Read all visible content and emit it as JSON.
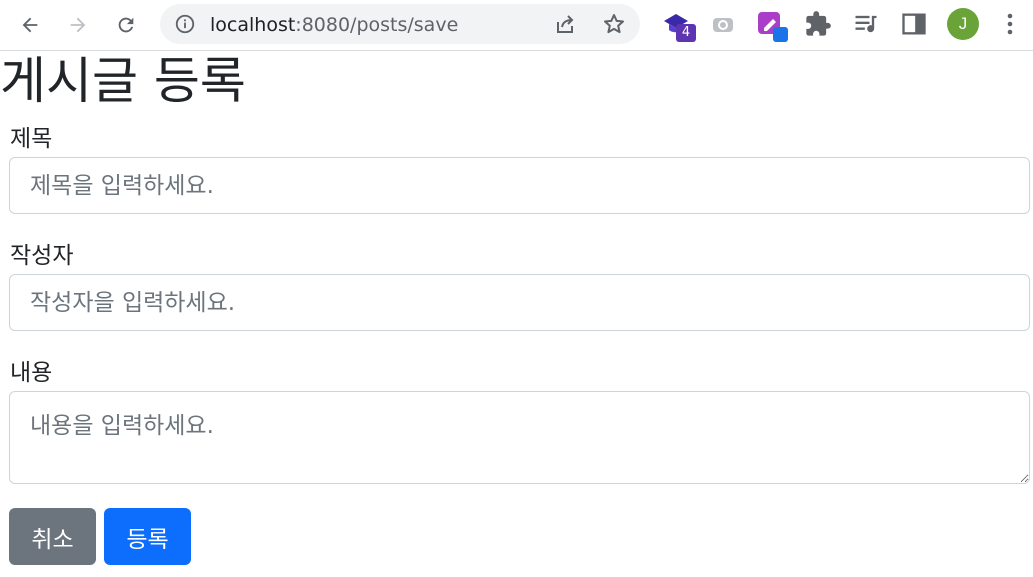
{
  "browser": {
    "url_host": "localhost",
    "url_path": ":8080/posts/save",
    "extension_badge": "4",
    "profile_initial": "J"
  },
  "page": {
    "title": "게시글 등록",
    "fields": {
      "title_label": "제목",
      "title_placeholder": "제목을 입력하세요.",
      "author_label": "작성자",
      "author_placeholder": "작성자을 입력하세요.",
      "content_label": "내용",
      "content_placeholder": "내용을 입력하세요."
    },
    "buttons": {
      "cancel": "취소",
      "save": "등록"
    }
  },
  "colors": {
    "cancel_button": "#6c757d",
    "save_button": "#0d6efd",
    "avatar": "#6aa338"
  }
}
